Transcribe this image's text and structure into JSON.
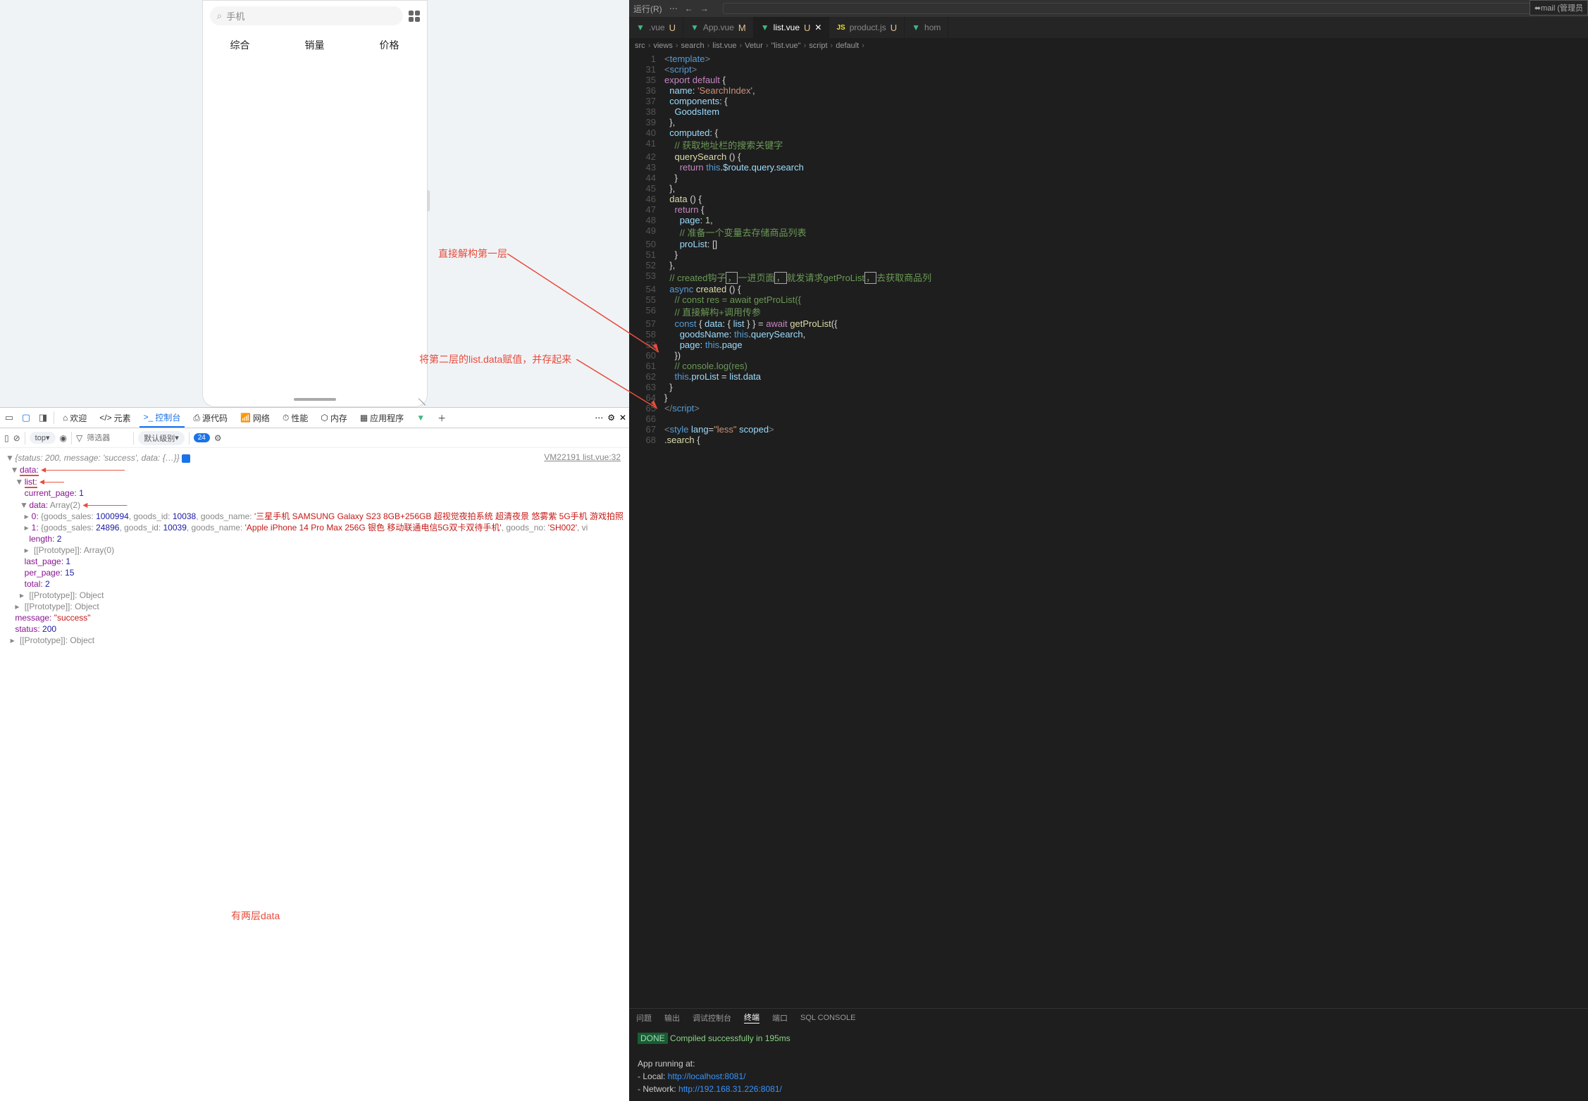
{
  "phone": {
    "search_placeholder": "手机",
    "tabs": [
      "综合",
      "销量",
      "价格"
    ]
  },
  "annotations": {
    "a1": "直接解构第一层",
    "a2": "将第二层的list.data赋值，并存起来",
    "a3": "有两层data",
    "a4": "两层"
  },
  "devtools": {
    "tabs": {
      "welcome": "欢迎",
      "elements": "元素",
      "console": "控制台",
      "sources": "源代码",
      "network": "网络",
      "performance": "性能",
      "memory": "内存",
      "application": "应用程序"
    },
    "sub": {
      "top": "top",
      "filter_placeholder": "筛选器",
      "level": "默认级别",
      "count": "24"
    },
    "log_link": "VM22191 list.vue:32"
  },
  "consoleTree": {
    "root": "{status: 200, message: 'success', data: {…}}",
    "data": "data:",
    "list": "list:",
    "current_page_k": "current_page: ",
    "current_page_v": "1",
    "data2_k": "data: ",
    "data2_v": "Array(2)",
    "item0_pre": "0: ",
    "item0_a": "{goods_sales: ",
    "item0_sales": "1000994",
    "item0_b": ", goods_id: ",
    "item0_id": "10038",
    "item0_c": ", goods_name: ",
    "item0_name": "'三星手机 SAMSUNG Galaxy S23 8GB+256GB 超视觉夜拍系统 超清夜景 悠雾紫 5G手机 游戏拍照",
    "item1_pre": "1: ",
    "item1_a": "{goods_sales: ",
    "item1_sales": "24896",
    "item1_b": ", goods_id: ",
    "item1_id": "10039",
    "item1_c": ", goods_name: ",
    "item1_name": "'Apple iPhone 14 Pro Max 256G 银色 移动联通电信5G双卡双待手机'",
    "item1_d": ", goods_no: ",
    "item1_no": "'SH002'",
    "item1_e": ", vi",
    "length_k": "length: ",
    "length_v": "2",
    "proto_arr": "[[Prototype]]: ",
    "proto_arr_v": "Array(0)",
    "last_page_k": "last_page: ",
    "last_page_v": "1",
    "per_page_k": "per_page: ",
    "per_page_v": "15",
    "total_k": "total: ",
    "total_v": "2",
    "proto_obj": "[[Prototype]]: ",
    "proto_obj_v": "Object",
    "message_k": "message: ",
    "message_v": "\"success\"",
    "status_k": "status: ",
    "status_v": "200"
  },
  "vscode": {
    "menu": "运行(R)",
    "tabs": [
      {
        "name": ".vue",
        "status": "U"
      },
      {
        "name": "App.vue",
        "status": "M"
      },
      {
        "name": "list.vue",
        "status": "U",
        "active": true
      },
      {
        "name": "product.js",
        "status": "U"
      },
      {
        "name": "hom",
        "status": ""
      }
    ],
    "extra": "mail (管理员",
    "breadcrumb": [
      "src",
      "views",
      "search",
      "list.vue",
      "Vetur",
      "\"list.vue\"",
      "script",
      "default"
    ],
    "term_tabs": [
      "问题",
      "输出",
      "调试控制台",
      "终端",
      "端口",
      "SQL CONSOLE"
    ],
    "terminal": {
      "done": "DONE",
      "compiled": "Compiled successfully in 195ms",
      "running": "App running at:",
      "local": "- Local:   ",
      "local_url": "http://localhost:8081/",
      "network": "- Network: ",
      "network_url": "http://192.168.31.226:8081/"
    }
  },
  "code": [
    {
      "n": 1,
      "h": "<span class='t-tag'>&lt;</span><span class='t-kw'>template</span><span class='t-tag'>&gt;</span>"
    },
    {
      "n": 31,
      "h": "<span class='t-tag'>&lt;</span><span class='t-kw'>script</span><span class='t-tag'>&gt;</span>"
    },
    {
      "n": 35,
      "h": "<span class='t-kw2'>export</span> <span class='t-kw2'>default</span> <span class='t-white'>{</span>"
    },
    {
      "n": 36,
      "h": "  <span class='t-var'>name</span><span class='t-white'>:</span> <span class='t-str'>'SearchIndex'</span><span class='t-white'>,</span>"
    },
    {
      "n": 37,
      "h": "  <span class='t-var'>components</span><span class='t-white'>: {</span>"
    },
    {
      "n": 38,
      "h": "    <span class='t-var'>GoodsItem</span>"
    },
    {
      "n": 39,
      "h": "  <span class='t-white'>},</span>"
    },
    {
      "n": 40,
      "h": "  <span class='t-var'>computed</span><span class='t-white'>: {</span>"
    },
    {
      "n": 41,
      "h": "    <span class='t-com'>// 获取地址栏的搜索关键字</span>"
    },
    {
      "n": 42,
      "h": "    <span class='t-fn'>querySearch</span> <span class='t-white'>() {</span>"
    },
    {
      "n": 43,
      "h": "      <span class='t-kw2'>return</span> <span class='t-kw'>this</span><span class='t-white'>.</span><span class='t-var'>$route</span><span class='t-white'>.</span><span class='t-var'>query</span><span class='t-white'>.</span><span class='t-var'>search</span>"
    },
    {
      "n": 44,
      "h": "    <span class='t-white'>}</span>"
    },
    {
      "n": 45,
      "h": "  <span class='t-white'>},</span>"
    },
    {
      "n": 46,
      "h": "  <span class='t-fn'>data</span> <span class='t-white'>() {</span>"
    },
    {
      "n": 47,
      "h": "    <span class='t-kw2'>return</span> <span class='t-white'>{</span>"
    },
    {
      "n": 48,
      "h": "      <span class='t-var'>page</span><span class='t-white'>:</span> <span class='t-num'>1</span><span class='t-white'>,</span>"
    },
    {
      "n": 49,
      "h": "      <span class='t-com'>// 准备一个变量去存储商品列表</span>"
    },
    {
      "n": 50,
      "h": "      <span class='t-var'>proList</span><span class='t-white'>: []</span>"
    },
    {
      "n": 51,
      "h": "    <span class='t-white'>}</span>"
    },
    {
      "n": 52,
      "h": "  <span class='t-white'>},</span>"
    },
    {
      "n": 53,
      "h": "  <span class='t-com'>// created钩子<span class='box'>，</span>一进页面<span class='box'>，</span>就发请求getProList<span class='box'>，</span>去获取商品列</span>"
    },
    {
      "n": 54,
      "h": "  <span class='t-kw'>async</span> <span class='t-fn'>created</span> <span class='t-white'>() {</span>"
    },
    {
      "n": 55,
      "h": "    <span class='t-com'>// const res = await getProList({</span>"
    },
    {
      "n": 56,
      "h": "    <span class='t-com'>// 直接解构+调用传参</span>"
    },
    {
      "n": 57,
      "h": "    <span class='t-kw'>const</span> <span class='t-white'>{ </span><span class='t-var'>data</span><span class='t-white'>: { </span><span class='t-var'>list</span><span class='t-white'> } } = </span><span class='t-kw2'>await</span> <span class='t-fn'>getProList</span><span class='t-white'>({</span>"
    },
    {
      "n": 58,
      "h": "      <span class='t-var'>goodsName</span><span class='t-white'>:</span> <span class='t-kw'>this</span><span class='t-white'>.</span><span class='t-var'>querySearch</span><span class='t-white'>,</span>"
    },
    {
      "n": 59,
      "h": "      <span class='t-var'>page</span><span class='t-white'>:</span> <span class='t-kw'>this</span><span class='t-white'>.</span><span class='t-var'>page</span>"
    },
    {
      "n": 60,
      "h": "    <span class='t-white'>})</span>"
    },
    {
      "n": 61,
      "h": "    <span class='t-com'>// console.log(res)</span>"
    },
    {
      "n": 62,
      "h": "    <span class='t-kw'>this</span><span class='t-white'>.</span><span class='t-var'>proList</span> <span class='t-white'>=</span> <span class='t-var'>list</span><span class='t-white'>.</span><span class='t-var'>data</span>"
    },
    {
      "n": 63,
      "h": "  <span class='t-white'>}</span>"
    },
    {
      "n": 64,
      "h": "<span class='t-white'>}</span>"
    },
    {
      "n": 65,
      "h": "<span class='t-tag'>&lt;/</span><span class='t-kw'>script</span><span class='t-tag'>&gt;</span>"
    },
    {
      "n": 66,
      "h": ""
    },
    {
      "n": 67,
      "h": "<span class='t-tag'>&lt;</span><span class='t-kw'>style</span> <span class='t-var'>lang</span><span class='t-white'>=</span><span class='t-str'>\"less\"</span> <span class='t-var'>scoped</span><span class='t-tag'>&gt;</span>"
    },
    {
      "n": 68,
      "h": "<span class='t-fn'>.search</span> <span class='t-white'>{</span>"
    }
  ]
}
